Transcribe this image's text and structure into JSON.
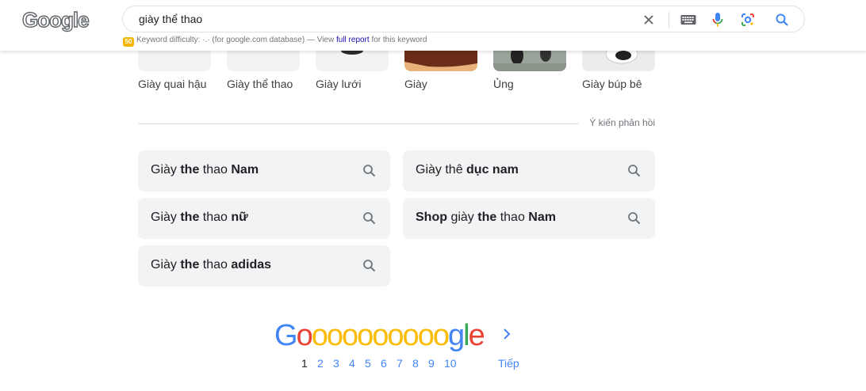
{
  "header": {
    "logo_text": "Google",
    "search_value": "giày thể thao"
  },
  "keyword_bar": {
    "badge": "50",
    "prefix": "Keyword difficulty: ",
    "dots": "·.·",
    "mid": " (for google.com database) — View ",
    "link": "full report",
    "suffix": " for this keyword"
  },
  "images": [
    {
      "label": "Giày quai hậu"
    },
    {
      "label": "Giày thể thao"
    },
    {
      "label": "Giày lưới"
    },
    {
      "label": "Giày"
    },
    {
      "label": "Ủng"
    },
    {
      "label": "Giày búp bê"
    }
  ],
  "feedback": "Ý kiến phản hồi",
  "related": [
    {
      "parts": [
        {
          "t": "Giày ",
          "b": false
        },
        {
          "t": "the",
          "b": true
        },
        {
          "t": " thao ",
          "b": false
        },
        {
          "t": "Nam",
          "b": true
        }
      ]
    },
    {
      "parts": [
        {
          "t": "Giày thê ",
          "b": false
        },
        {
          "t": "dục nam",
          "b": true
        }
      ]
    },
    {
      "parts": [
        {
          "t": "Giày ",
          "b": false
        },
        {
          "t": "the",
          "b": true
        },
        {
          "t": " thao ",
          "b": false
        },
        {
          "t": "nữ",
          "b": true
        }
      ]
    },
    {
      "parts": [
        {
          "t": "Shop",
          "b": true
        },
        {
          "t": " giày ",
          "b": false
        },
        {
          "t": "the",
          "b": true
        },
        {
          "t": " thao ",
          "b": false
        },
        {
          "t": "Nam",
          "b": true
        }
      ]
    },
    {
      "parts": [
        {
          "t": "Giày ",
          "b": false
        },
        {
          "t": "the",
          "b": true
        },
        {
          "t": " thao ",
          "b": false
        },
        {
          "t": "adidas",
          "b": true
        }
      ]
    }
  ],
  "pager": {
    "letters": [
      {
        "ch": "G",
        "color": "#4285f4"
      },
      {
        "ch": "o",
        "color": "#ea4335"
      },
      {
        "ch": "o",
        "color": "#fbbc05"
      },
      {
        "ch": "o",
        "color": "#fbbc05"
      },
      {
        "ch": "o",
        "color": "#fbbc05"
      },
      {
        "ch": "o",
        "color": "#fbbc05"
      },
      {
        "ch": "o",
        "color": "#fbbc05"
      },
      {
        "ch": "o",
        "color": "#fbbc05"
      },
      {
        "ch": "o",
        "color": "#fbbc05"
      },
      {
        "ch": "o",
        "color": "#fbbc05"
      },
      {
        "ch": "o",
        "color": "#fbbc05"
      },
      {
        "ch": "g",
        "color": "#4285f4"
      },
      {
        "ch": "l",
        "color": "#34a853"
      },
      {
        "ch": "e",
        "color": "#ea4335"
      }
    ],
    "pages": [
      "1",
      "2",
      "3",
      "4",
      "5",
      "6",
      "7",
      "8",
      "9",
      "10"
    ],
    "current": "1",
    "next_label": "Tiếp"
  }
}
